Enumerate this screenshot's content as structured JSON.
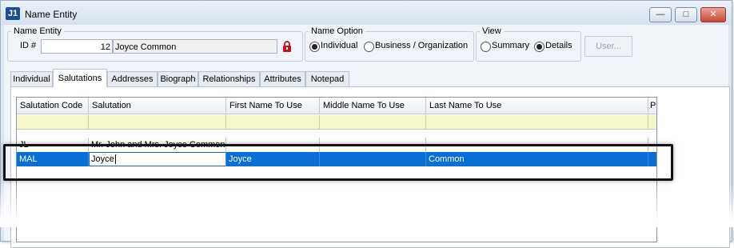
{
  "window": {
    "title": "Name Entity",
    "app_icon_text": "J1",
    "controls": [
      "minimize",
      "maximize",
      "close"
    ]
  },
  "name_entity": {
    "group_label": "Name Entity",
    "id_label": "ID #",
    "id_value": "12",
    "name_value": "Joyce Common"
  },
  "name_option": {
    "group_label": "Name Option",
    "options": [
      {
        "label": "Individual",
        "selected": true
      },
      {
        "label": "Business / Organization",
        "selected": false
      }
    ]
  },
  "view": {
    "group_label": "View",
    "options": [
      {
        "label": "Summary",
        "selected": false
      },
      {
        "label": "Details",
        "selected": true
      }
    ]
  },
  "user_button": "User...",
  "tabs": [
    {
      "label": "Individual",
      "active": false
    },
    {
      "label": "Salutations",
      "active": true
    },
    {
      "label": "Addresses",
      "active": false
    },
    {
      "label": "Biograph",
      "active": false
    },
    {
      "label": "Relationships",
      "active": false
    },
    {
      "label": "Attributes",
      "active": false
    },
    {
      "label": "Notepad",
      "active": false
    }
  ],
  "grid": {
    "columns": [
      "Salutation Code",
      "Salutation",
      "First Name To Use",
      "Middle Name To Use",
      "Last Name To Use",
      "Pr"
    ],
    "rows": [
      [
        "JL",
        "Mr. John and Mrs. Joyce Common",
        "",
        "",
        "",
        ""
      ],
      [
        "MAL",
        "Joyce",
        "Joyce",
        "",
        "Common",
        ""
      ]
    ],
    "selected_row": 1,
    "editing_value": "Joyce"
  },
  "colors": {
    "selection": "#0a6fd4",
    "filter_row": "#f5f7c8",
    "lock": "#c0141c"
  }
}
